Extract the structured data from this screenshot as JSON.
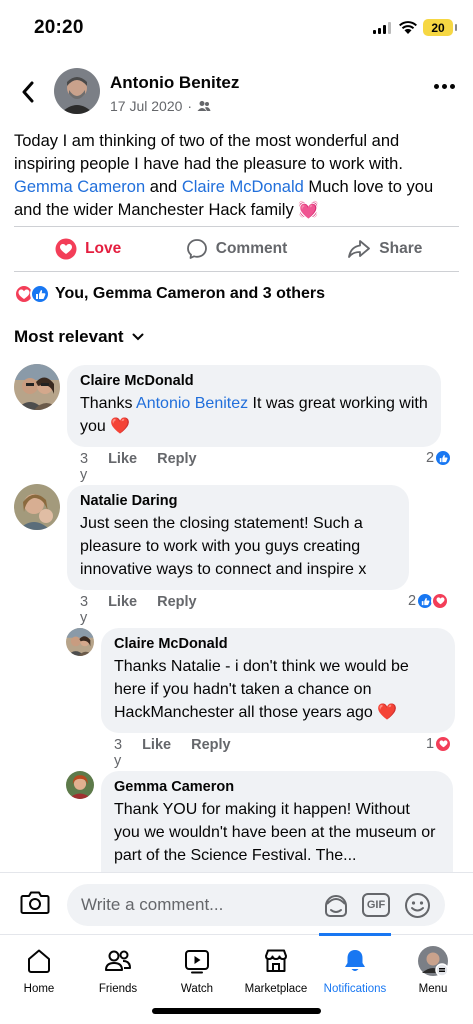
{
  "status": {
    "time": "20:20",
    "battery": "20"
  },
  "post": {
    "author": "Antonio Benitez",
    "date": "17 Jul 2020",
    "separator": "·",
    "text_intro": "Today I am thinking of two of the most wonderful and inspiring people I have had the pleasure to work with. ",
    "mention_1": "Gemma Cameron",
    "text_and": " and ",
    "mention_2": "Claire McDonald",
    "text_outro": " Much love to you and the wider Manchester Hack family ",
    "emoji": "💓"
  },
  "actions": {
    "love": "Love",
    "comment": "Comment",
    "share": "Share"
  },
  "reactions_summary": "You, Gemma Cameron and 3 others",
  "sort_label": "Most relevant",
  "comments": [
    {
      "name": "Claire McDonald",
      "text_before": "Thanks ",
      "mention": "Antonio Benitez",
      "text_after": " It was great working with you ",
      "emoji": "❤️",
      "time": "3 y",
      "like": "Like",
      "reply": "Reply",
      "reaction_count": "2"
    },
    {
      "name": "Natalie Daring",
      "text": "Just seen the closing statement! Such a pleasure to work with you guys creating innovative ways to connect and inspire x",
      "time": "3 y",
      "like": "Like",
      "reply": "Reply",
      "reaction_count": "2"
    },
    {
      "name": "Claire McDonald",
      "text": "Thanks Natalie - i don't think we would be here if you hadn't taken a chance on HackManchester all those years ago ",
      "emoji": "❤️",
      "time": "3 y",
      "like": "Like",
      "reply": "Reply",
      "reaction_count": "1"
    },
    {
      "name": "Gemma Cameron",
      "text": "Thank YOU for making it happen! Without you we wouldn't have been at the museum or part of the Science Festival. The..."
    }
  ],
  "composer": {
    "placeholder": "Write a comment...",
    "gif": "GIF"
  },
  "tabs": [
    {
      "label": "Home",
      "icon": "home-icon"
    },
    {
      "label": "Friends",
      "icon": "friends-icon"
    },
    {
      "label": "Watch",
      "icon": "watch-icon"
    },
    {
      "label": "Marketplace",
      "icon": "marketplace-icon"
    },
    {
      "label": "Notifications",
      "icon": "bell-icon",
      "active": true
    },
    {
      "label": "Menu",
      "icon": "avatar-menu-icon"
    }
  ],
  "colors": {
    "accent": "#1877f2",
    "love": "#e41e3f",
    "mention": "#216fdb",
    "bubble": "#f0f2f5",
    "muted": "#65676b"
  }
}
